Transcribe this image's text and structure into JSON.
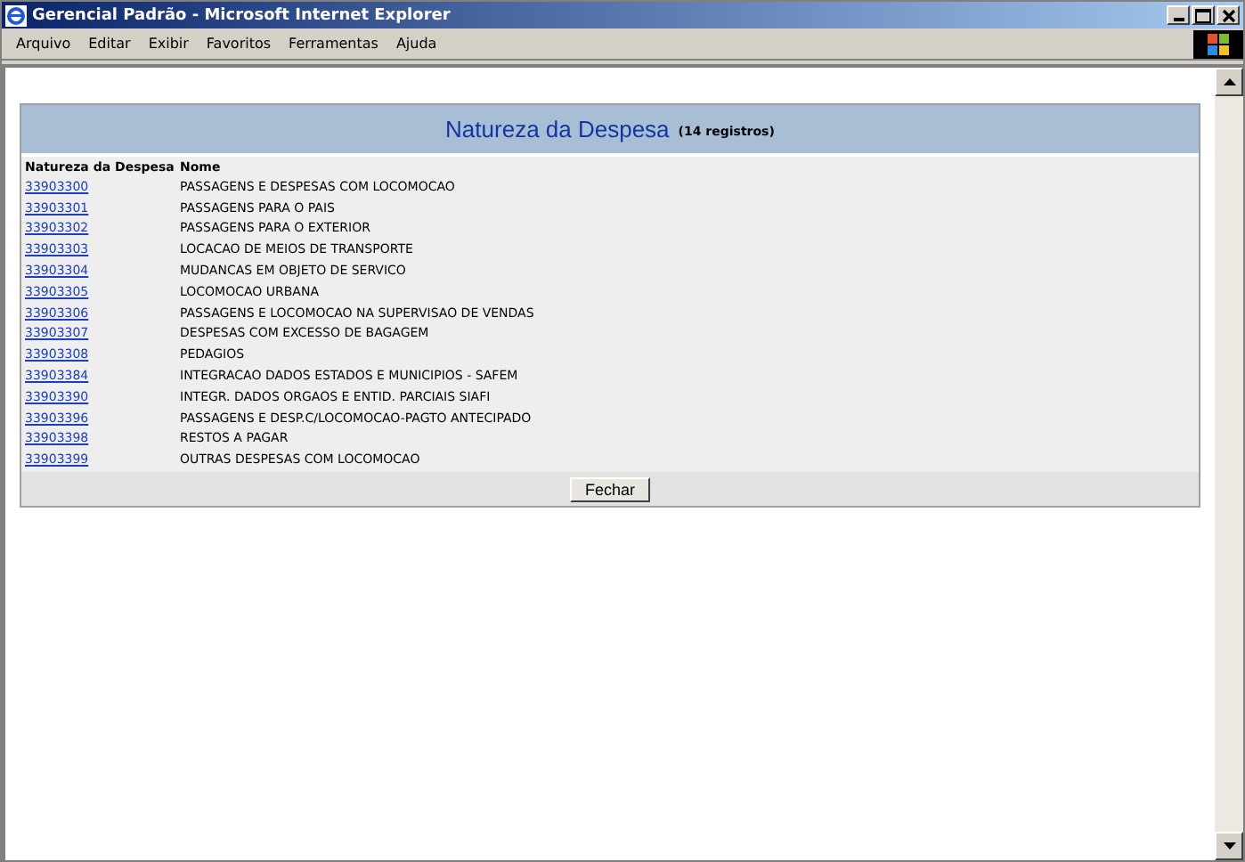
{
  "window": {
    "title": "Gerencial Padrão - Microsoft Internet Explorer"
  },
  "menu": [
    "Arquivo",
    "Editar",
    "Exibir",
    "Favoritos",
    "Ferramentas",
    "Ajuda"
  ],
  "panel": {
    "title": "Natureza da Despesa",
    "count": "(14 registros)",
    "columns": [
      "Natureza da Despesa",
      "Nome"
    ],
    "rows": [
      {
        "code": "33903300",
        "name": "PASSAGENS E DESPESAS COM LOCOMOCAO"
      },
      {
        "code": "33903301",
        "name": "PASSAGENS PARA O PAIS"
      },
      {
        "code": "33903302",
        "name": "PASSAGENS PARA O EXTERIOR"
      },
      {
        "code": "33903303",
        "name": "LOCACAO DE MEIOS DE TRANSPORTE"
      },
      {
        "code": "33903304",
        "name": "MUDANCAS EM OBJETO DE SERVICO"
      },
      {
        "code": "33903305",
        "name": "LOCOMOCAO URBANA"
      },
      {
        "code": "33903306",
        "name": "PASSAGENS E LOCOMOCAO NA SUPERVISAO DE VENDAS"
      },
      {
        "code": "33903307",
        "name": "DESPESAS COM EXCESSO DE BAGAGEM"
      },
      {
        "code": "33903308",
        "name": "PEDAGIOS"
      },
      {
        "code": "33903384",
        "name": "INTEGRACAO DADOS ESTADOS E MUNICIPIOS - SAFEM"
      },
      {
        "code": "33903390",
        "name": "INTEGR. DADOS ORGAOS E ENTID. PARCIAIS SIAFI"
      },
      {
        "code": "33903396",
        "name": "PASSAGENS E DESP.C/LOCOMOCAO-PAGTO ANTECIPADO"
      },
      {
        "code": "33903398",
        "name": "RESTOS A PAGAR"
      },
      {
        "code": "33903399",
        "name": "OUTRAS DESPESAS COM LOCOMOCAO"
      }
    ],
    "button": "Fechar"
  }
}
